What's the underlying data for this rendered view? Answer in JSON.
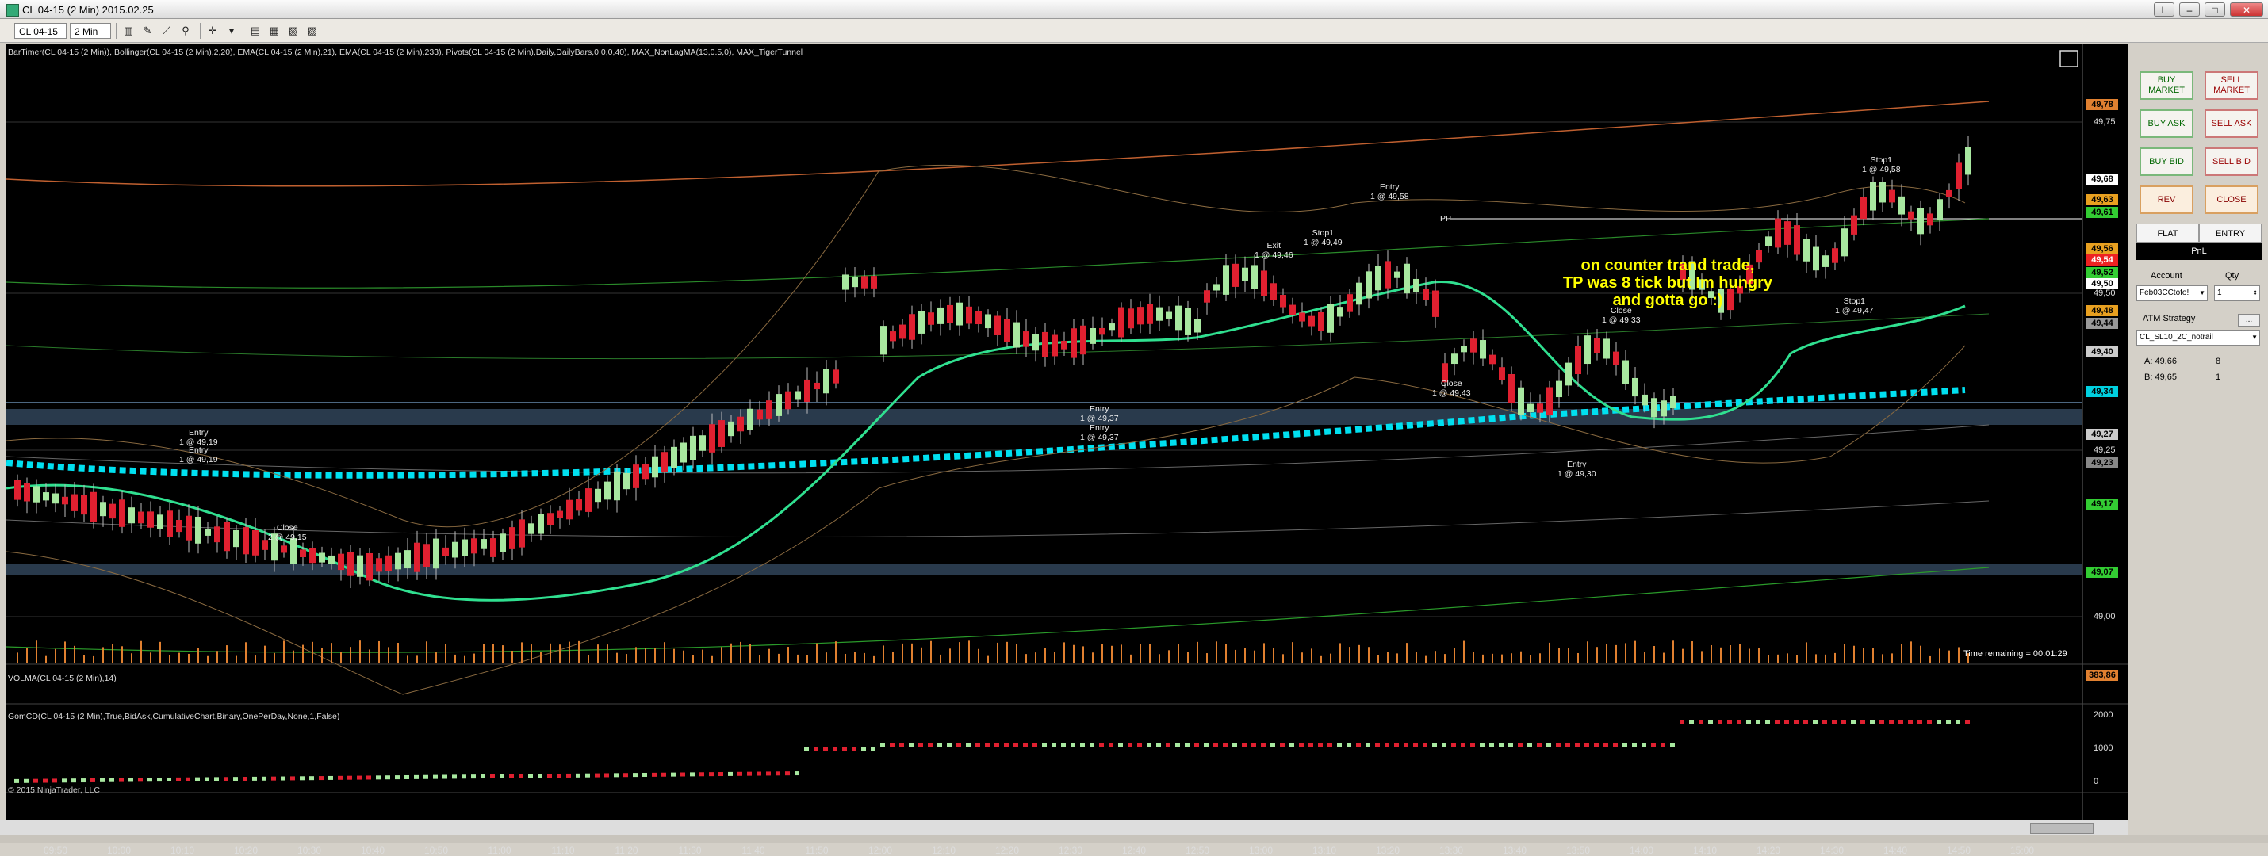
{
  "window": {
    "title": "CL 04-15 (2 Min)  2015.02.25",
    "restore_btn": "L",
    "minimize_btn": "–",
    "maximize_btn": "□",
    "close_btn": "✕"
  },
  "toolbar": {
    "instrument": "CL 04-15",
    "interval": "2 Min"
  },
  "price_panel": {
    "indicators_label": "BarTimer(CL 04-15 (2 Min)), Bollinger(CL 04-15 (2 Min),2,20), EMA(CL 04-15 (2 Min),21), EMA(CL 04-15 (2 Min),233), Pivots(CL 04-15 (2 Min),Daily,DailyBars,0,0,0,40), MAX_NonLagMA(13,0.5,0), MAX_TigerTunnel",
    "time_remaining": "Time remaining = 00:01:29",
    "comment_lines": [
      "on counter trand trade,",
      "TP was 8 tick but Im hungry",
      "and gotta go :)"
    ],
    "pivot_label": "PP",
    "axis_labels": [
      "49,75",
      "49,50",
      "49,25",
      "49,00"
    ],
    "price_tags": [
      {
        "text": "49,78",
        "bg": "#e08030",
        "fg": "#000"
      },
      {
        "text": "49,68",
        "bg": "#ffffff",
        "fg": "#000"
      },
      {
        "text": "49,63",
        "bg": "#e8a020",
        "fg": "#000"
      },
      {
        "text": "49,61",
        "bg": "#33cc33",
        "fg": "#000"
      },
      {
        "text": "49,56",
        "bg": "#e8a020",
        "fg": "#000"
      },
      {
        "text": "49,54",
        "bg": "#ee2222",
        "fg": "#fff"
      },
      {
        "text": "49,52",
        "bg": "#33cc33",
        "fg": "#000"
      },
      {
        "text": "49,50",
        "bg": "#ffffff",
        "fg": "#000"
      },
      {
        "text": "49,48",
        "bg": "#e8a020",
        "fg": "#000"
      },
      {
        "text": "49,44",
        "bg": "#999999",
        "fg": "#000"
      },
      {
        "text": "49,40",
        "bg": "#cccccc",
        "fg": "#000"
      },
      {
        "text": "49,34",
        "bg": "#00d0e0",
        "fg": "#000"
      },
      {
        "text": "49,27",
        "bg": "#cccccc",
        "fg": "#000"
      },
      {
        "text": "49,23",
        "bg": "#888888",
        "fg": "#000"
      },
      {
        "text": "49,17",
        "bg": "#33cc33",
        "fg": "#000"
      },
      {
        "text": "49,07",
        "bg": "#33cc33",
        "fg": "#000"
      }
    ],
    "trade_labels": [
      {
        "text": "Entry\n1 @ 49,19"
      },
      {
        "text": "Entry\n1 @ 49,19"
      },
      {
        "text": "Close\n2 @ 49,15"
      },
      {
        "text": "Entry\n1 @ 49,37"
      },
      {
        "text": "Entry\n1 @ 49,37"
      },
      {
        "text": "Exit\n1 @ 49,46"
      },
      {
        "text": "Stop1\n1 @ 49,49"
      },
      {
        "text": "Entry\n1 @ 49,58"
      },
      {
        "text": "Close\n1 @ 49,43"
      },
      {
        "text": "Close\n1 @ 49,33"
      },
      {
        "text": "Entry\n1 @ 49,30"
      },
      {
        "text": "Stop1\n1 @ 49,58"
      },
      {
        "text": "Stop1\n1 @ 49,47"
      }
    ]
  },
  "volume_panel": {
    "label": "VOLMA(CL 04-15 (2 Min),14)",
    "tag": "383,86"
  },
  "gomcd_panel": {
    "label": "GomCD(CL 04-15 (2 Min),True,BidAsk,CumulativeChart,Binary,OnePerDay,None,1,False)",
    "axis_labels": [
      "2000",
      "1000",
      "0"
    ],
    "copyright": "© 2015 NinjaTrader, LLC"
  },
  "time_axis": [
    "09:50",
    "10:00",
    "10:10",
    "10:20",
    "10:30",
    "10:40",
    "10:50",
    "11:00",
    "11:10",
    "11:20",
    "11:30",
    "11:40",
    "11:50",
    "12:00",
    "12:10",
    "12:20",
    "12:30",
    "12:40",
    "12:50",
    "13:00",
    "13:10",
    "13:20",
    "13:30",
    "13:40",
    "13:50",
    "14:00",
    "14:10",
    "14:20",
    "14:30",
    "14:40",
    "14:50",
    "15:00"
  ],
  "order_panel": {
    "buy_market": "BUY MARKET",
    "sell_market": "SELL MARKET",
    "buy_ask": "BUY ASK",
    "sell_ask": "SELL ASK",
    "buy_bid": "BUY BID",
    "sell_bid": "SELL BID",
    "rev": "REV",
    "close": "CLOSE",
    "position": "FLAT",
    "entry": "ENTRY",
    "pnl": "PnL",
    "account_label": "Account",
    "account_value": "Feb03CCtofo!",
    "qty_label": "Qty",
    "qty_value": "1",
    "atm_label": "ATM Strategy",
    "atm_dots": "...",
    "atm_value": "CL_SL10_2C_notrail",
    "ask_label": "A: 49,66",
    "ask_size": "8",
    "bid_label": "B: 49,65",
    "bid_size": "1"
  }
}
